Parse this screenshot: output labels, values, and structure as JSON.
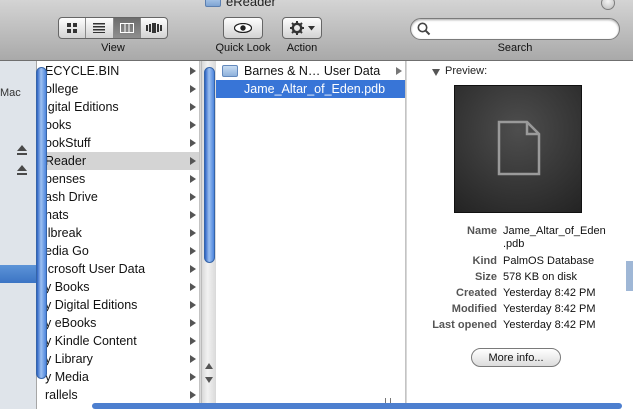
{
  "window": {
    "title": "eReader"
  },
  "toolbar": {
    "view_label": "View",
    "quicklook_label": "Quick Look",
    "action_label": "Action",
    "search_label": "Search",
    "search_value": "",
    "active_view": "column"
  },
  "sidebar": {
    "device_label": "Mac"
  },
  "column1": {
    "items": [
      {
        "label": "ECYCLE.BIN"
      },
      {
        "label": "ollege"
      },
      {
        "label": "igital Editions"
      },
      {
        "label": "ooks"
      },
      {
        "label": "ookStuff"
      },
      {
        "label": "Reader"
      },
      {
        "label": "penses"
      },
      {
        "label": "ash Drive"
      },
      {
        "label": "hats"
      },
      {
        "label": "ilbreak"
      },
      {
        "label": "edia Go"
      },
      {
        "label": "icrosoft User Data"
      },
      {
        "label": "y Books"
      },
      {
        "label": "y Digital Editions"
      },
      {
        "label": "y eBooks"
      },
      {
        "label": "y Kindle Content"
      },
      {
        "label": "y Library"
      },
      {
        "label": "y Media"
      },
      {
        "label": "rallels"
      }
    ],
    "highlighted_index": 5
  },
  "column2": {
    "items": [
      {
        "label": "Barnes & N… User Data"
      },
      {
        "label": "Jame_Altar_of_Eden.pdb"
      }
    ],
    "selected_index": 1
  },
  "preview": {
    "heading": "Preview:",
    "info": [
      {
        "key": "Name",
        "value": "Jame_Altar_of_Eden"
      },
      {
        "key": "",
        "value": ".pdb"
      },
      {
        "key": "Kind",
        "value": "PalmOS Database"
      },
      {
        "key": "Size",
        "value": "578 KB on disk"
      },
      {
        "key": "Created",
        "value": "Yesterday 8:42 PM"
      },
      {
        "key": "Modified",
        "value": "Yesterday 8:42 PM"
      },
      {
        "key": "Last opened",
        "value": "Yesterday 8:42 PM"
      }
    ],
    "more_info_label": "More info..."
  },
  "colors": {
    "selection": "#3875d7",
    "highlight": "#d4d4d4",
    "scroll_thumb": "#4d85dd"
  }
}
